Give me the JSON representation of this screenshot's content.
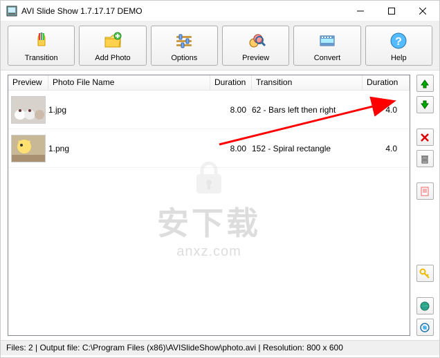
{
  "window": {
    "title": "AVI Slide Show 1.7.17.17 DEMO"
  },
  "toolbar": {
    "transition": "Transition",
    "add_photo": "Add Photo",
    "options": "Options",
    "preview": "Preview",
    "convert": "Convert",
    "help": "Help"
  },
  "grid": {
    "headers": {
      "preview": "Preview",
      "filename": "Photo File Name",
      "duration": "Duration",
      "transition": "Transition",
      "duration2": "Duration"
    },
    "rows": [
      {
        "filename": "1.jpg",
        "duration": "8.00",
        "transition": "62 - Bars left then right",
        "duration2": "4.0"
      },
      {
        "filename": "1.png",
        "duration": "8.00",
        "transition": "152 - Spiral rectangle",
        "duration2": "4.0"
      }
    ]
  },
  "statusbar": {
    "text": "Files: 2 | Output file: C:\\Program Files (x86)\\AVISlideShow\\photo.avi | Resolution: 800 x 600"
  },
  "watermark": {
    "line1": "安下载",
    "line2": "anxz.com"
  }
}
